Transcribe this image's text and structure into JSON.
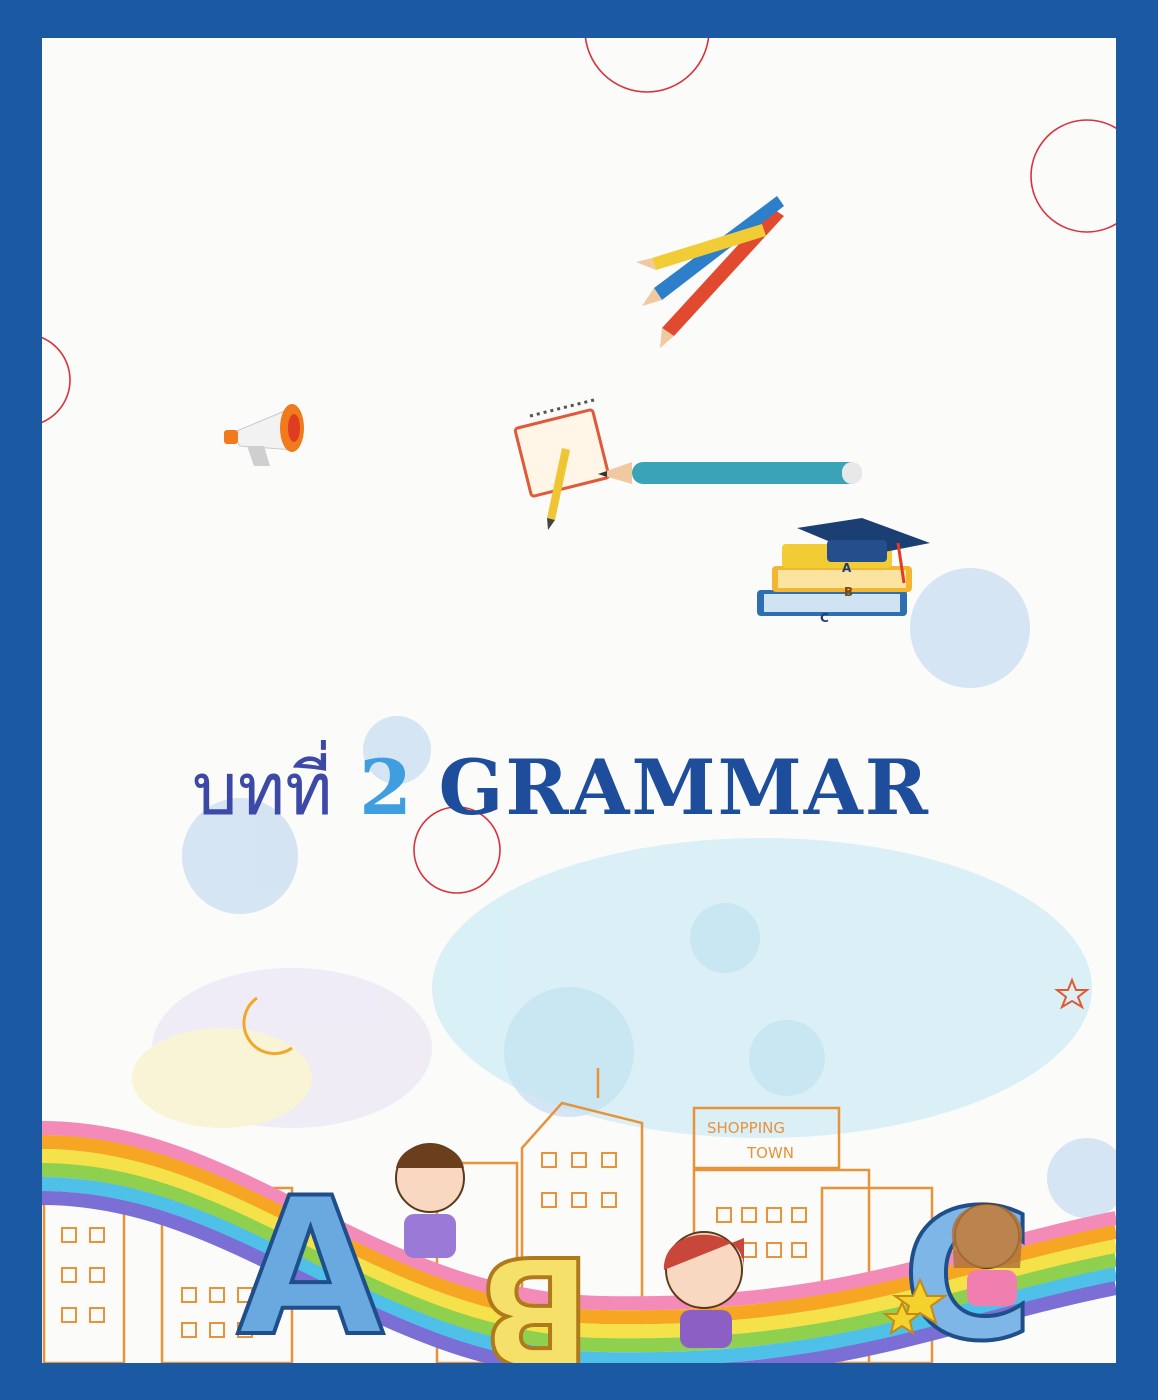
{
  "title": {
    "thai": "บทที่",
    "number": "2",
    "word": "GRAMMAR"
  },
  "signs": {
    "shop_line1": "SHOPPING",
    "shop_line2": "TOWN"
  },
  "blocks": {
    "a": "A",
    "b": "B",
    "c": "C"
  },
  "book_labels": {
    "a": "A",
    "b": "B",
    "c": "C"
  },
  "colors": {
    "frame": "#1b5aa3",
    "title_thai": "#3d49a6",
    "title_number": "#3f9ee0",
    "title_word": "#1d4d9b"
  }
}
